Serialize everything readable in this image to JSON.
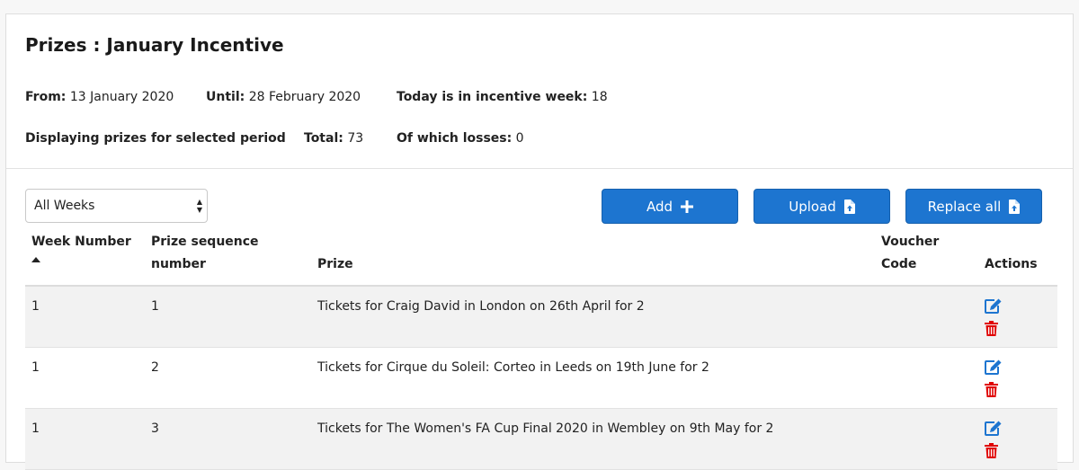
{
  "title": "Prizes : January Incentive",
  "meta": {
    "from_label": "From:",
    "from_value": "13 January 2020",
    "until_label": "Until:",
    "until_value": "28 February 2020",
    "week_label": "Today is in incentive week:",
    "week_value": "18",
    "displaying_label": "Displaying prizes for selected period",
    "total_label": "Total:",
    "total_value": "73",
    "losses_label": "Of which losses:",
    "losses_value": "0"
  },
  "filter": {
    "selected": "All Weeks"
  },
  "buttons": {
    "add": "Add",
    "upload": "Upload",
    "replace": "Replace all"
  },
  "table": {
    "headers": {
      "week": "Week Number",
      "seq_line1": "Prize sequence",
      "seq_line2": "number",
      "prize": "Prize",
      "voucher_line1": "Voucher",
      "voucher_line2": "Code",
      "actions": "Actions"
    },
    "rows": [
      {
        "week": "1",
        "seq": "1",
        "prize": "Tickets for Craig David in London on 26th April for 2",
        "voucher": ""
      },
      {
        "week": "1",
        "seq": "2",
        "prize": "Tickets for Cirque du Soleil: Corteo in Leeds on 19th June for 2",
        "voucher": ""
      },
      {
        "week": "1",
        "seq": "3",
        "prize": "Tickets for The Women's FA Cup Final 2020 in Wembley on 9th May for 2",
        "voucher": ""
      }
    ]
  },
  "colors": {
    "primary": "#1d75d0",
    "edit_icon": "#1d75d0",
    "delete_icon": "#e00000"
  },
  "icons": {
    "add": "plus-icon",
    "upload": "file-upload-icon",
    "replace": "file-upload-icon",
    "edit": "edit-icon",
    "delete": "trash-icon",
    "sort": "sort-asc-icon"
  }
}
